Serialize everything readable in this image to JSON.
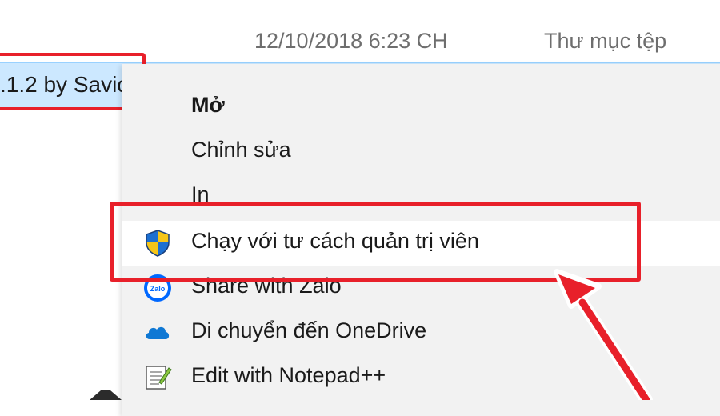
{
  "file_row": {
    "date": "12/10/2018 6:23 CH",
    "type": "Thư mục tệp"
  },
  "selected_file": {
    "name_fragment": ".1.2 by Savic"
  },
  "context_menu": {
    "items": [
      {
        "label": "Mở",
        "icon": "none",
        "bold": true
      },
      {
        "label": "Chỉnh sửa",
        "icon": "none"
      },
      {
        "label": "In",
        "icon": "none"
      },
      {
        "label": "Chạy với tư cách quản trị viên",
        "icon": "uac-shield-icon"
      },
      {
        "label": "Share with Zalo",
        "icon": "zalo-icon"
      },
      {
        "label": "Di chuyển đến OneDrive",
        "icon": "onedrive-cloud-icon"
      },
      {
        "label": "Edit with Notepad++",
        "icon": "notepad-plus-plus-icon"
      }
    ]
  },
  "annotation": {
    "highlight_color": "#e8202a",
    "accent_selection": "#cce8ff"
  }
}
